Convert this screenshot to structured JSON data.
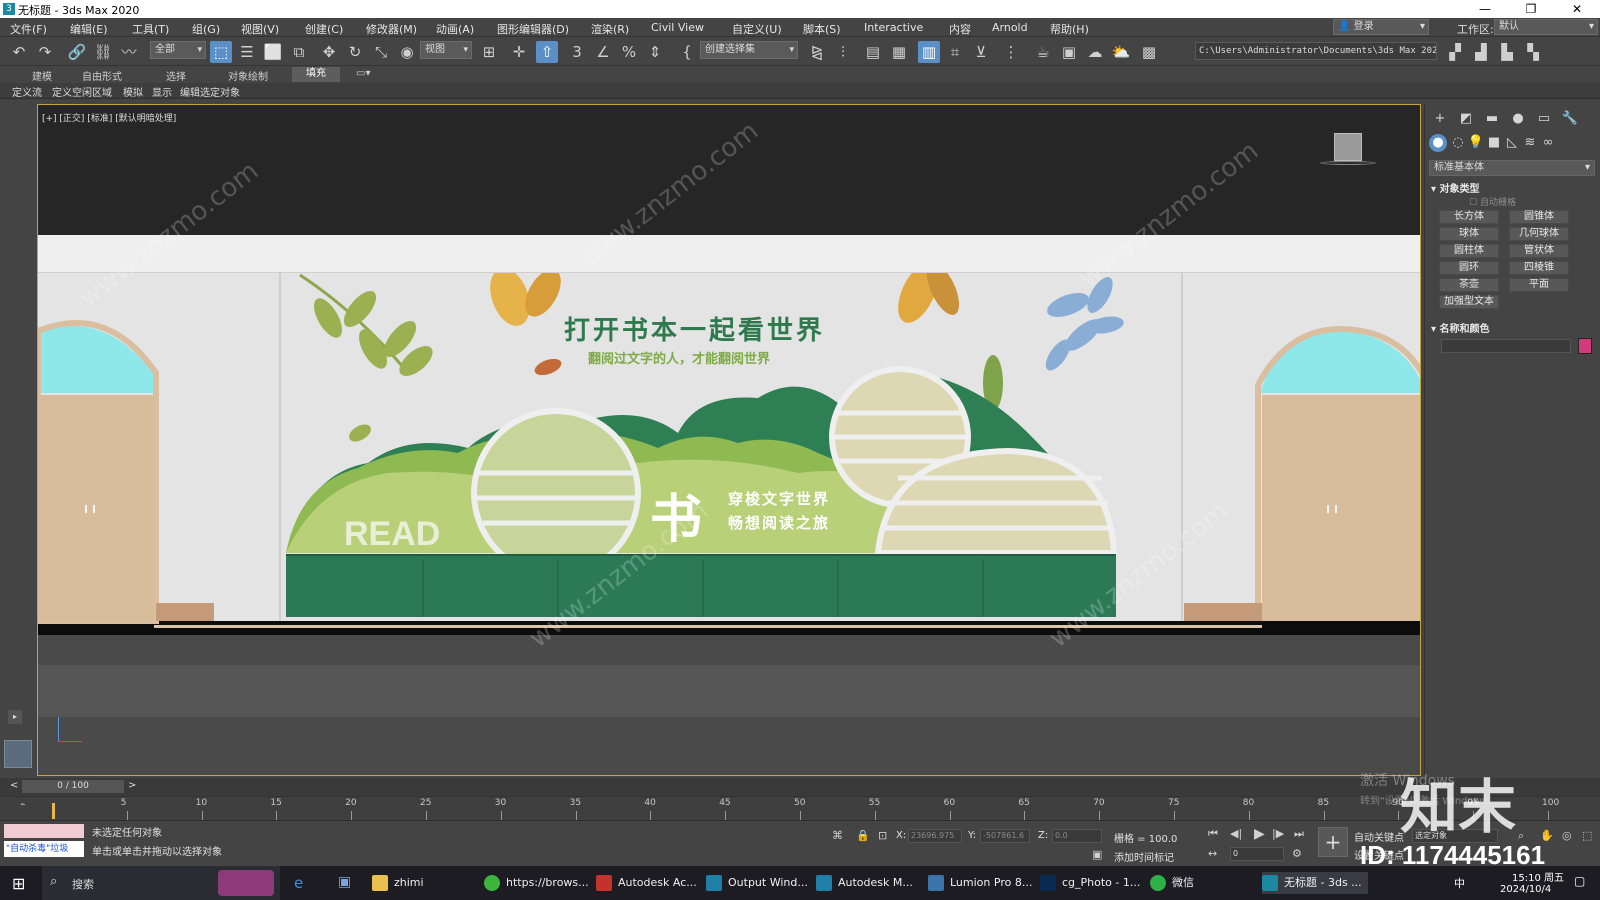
{
  "window": {
    "title": "无标题 - 3ds Max 2020",
    "app_icon": "3ds-max-icon",
    "controls": [
      "minimize",
      "restore",
      "close"
    ]
  },
  "menu": {
    "items": [
      "文件(F)",
      "编辑(E)",
      "工具(T)",
      "组(G)",
      "视图(V)",
      "创建(C)",
      "修改器(M)",
      "动画(A)",
      "图形编辑器(D)",
      "渲染(R)",
      "Civil View",
      "自定义(U)",
      "脚本(S)",
      "Interactive",
      "内容",
      "Arnold",
      "帮助(H)"
    ],
    "login": "登录",
    "workspace_label": "工作区:",
    "workspace_value": "默认"
  },
  "toolbar": {
    "selection_filter": "全部",
    "reference_coord": "视图",
    "named_selection": "创建选择集",
    "project_path": "C:\\Users\\Administrator\\Documents\\3ds Max 2020"
  },
  "ribbon": {
    "tabs": [
      "建模",
      "自由形式",
      "选择",
      "对象绘制",
      "填充"
    ],
    "active_tab": "填充",
    "subtabs": [
      "定义流",
      "定义空闲区域",
      "模拟",
      "显示",
      "编辑选定对象"
    ]
  },
  "viewport": {
    "label": "[+] [正交] [标准] [默认明暗处理]",
    "scene": {
      "headline": "打开书本一起看世界",
      "subline": "翻阅过文字的人，才能翻阅世界",
      "big_char": "书",
      "side_line1": "穿梭文字世界",
      "side_line2": "畅想阅读之旅",
      "read_text": "READ"
    }
  },
  "command_panel": {
    "dropdown": "标准基本体",
    "section_object_type": "对象类型",
    "auto_grid": "自动栅格",
    "buttons": [
      "长方体",
      "圆锥体",
      "球体",
      "几何球体",
      "圆柱体",
      "管状体",
      "圆环",
      "四棱锥",
      "茶壶",
      "平面",
      "加强型文本"
    ],
    "section_name_color": "名称和颜色",
    "object_color": "#d23a7b"
  },
  "timeline": {
    "frame_display": "0 / 100",
    "ticks": [
      "5",
      "10",
      "15",
      "20",
      "25",
      "30",
      "35",
      "40",
      "45",
      "50",
      "55",
      "60",
      "65",
      "70",
      "75",
      "80",
      "85",
      "90",
      "95",
      "100"
    ]
  },
  "status": {
    "script_listener": "\"自动杀毒\"垃圾",
    "line1": "未选定任何对象",
    "line2": "单击或单击并拖动以选择对象",
    "x_label": "X:",
    "x_value": "23696.975",
    "y_label": "Y:",
    "y_value": "-507861.6",
    "z_label": "Z:",
    "z_value": "0.0",
    "grid": "栅格 = 100.0",
    "add_time_tag": "添加时间标记",
    "auto_key": "自动关键点",
    "set_key": "设置关键点",
    "selected_object": "选定对象",
    "frame_field": "0"
  },
  "taskbar": {
    "search": "搜索",
    "items": [
      "zhimi",
      "https://brows...",
      "Autodesk Ac...",
      "Output Wind...",
      "Autodesk M...",
      "Lumion Pro 8...",
      "cg_Photo - 1...",
      "微信",
      "无标题 - 3ds ..."
    ],
    "time": "15:10 周五",
    "date": "2024/10/4",
    "ime": "中"
  },
  "watermark": {
    "site": "www.znzmo.com",
    "brand": "知末",
    "id": "ID: 1174445161",
    "activate_windows": "激活 Windows",
    "activate_sub": "转到\"设置\"以激活 Windows。"
  }
}
